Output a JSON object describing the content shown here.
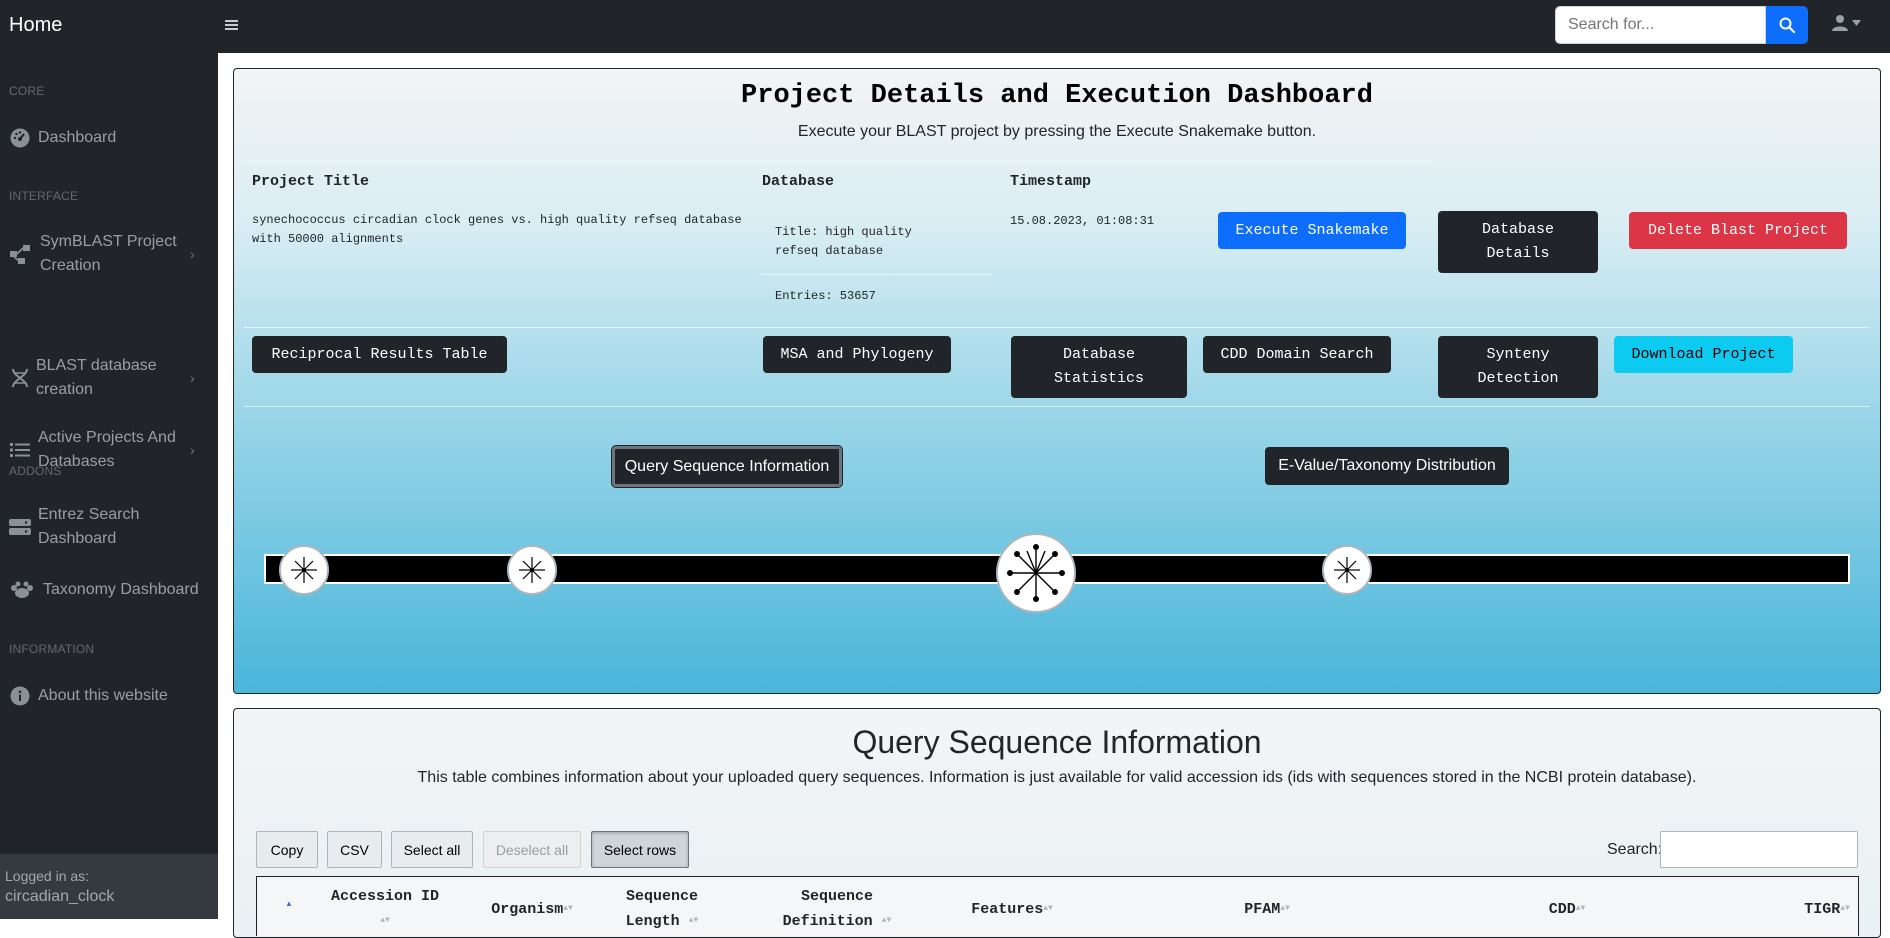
{
  "topbar": {
    "brand": "Home",
    "menu_icon": "hamburger-icon",
    "search_placeholder": "Search for...",
    "search_icon": "search-icon",
    "user_icon": "user-icon"
  },
  "sidebar": {
    "sections": {
      "core": "Core",
      "interface": "Interface",
      "addons": "Addons",
      "information": "Information"
    },
    "items": [
      {
        "label": "Dashboard",
        "icon": "dashboard-gauge-icon"
      },
      {
        "label": "SymBLAST Project Creation",
        "icon": "project-diagram-icon"
      },
      {
        "label": "BLAST database creation",
        "icon": "dna-icon"
      },
      {
        "label": "Active Projects And Databases",
        "icon": "list-icon"
      },
      {
        "label": "Entrez Search Dashboard",
        "icon": "server-icon"
      },
      {
        "label": "Taxonomy Dashboard",
        "icon": "paw-icon"
      },
      {
        "label": "About this website",
        "icon": "info-circle-icon"
      }
    ],
    "footer": {
      "label": "Logged in as:",
      "username": "circadian_clock"
    }
  },
  "dashboard": {
    "title": "Project Details and Execution Dashboard",
    "subtitle": "Execute your BLAST project by pressing the Execute Snakemake button.",
    "headers": {
      "project_title": "Project Title",
      "database": "Database",
      "timestamp": "Timestamp"
    },
    "project_title": "synechococcus circadian clock genes vs. high quality refseq database with 50000 alignments",
    "database_title": "Title: high quality refseq database",
    "database_entries": "Entries: 53657",
    "timestamp": "15.08.2023, 01:08:31",
    "buttons": {
      "execute": "Execute Snakemake",
      "database_details": "Database Details",
      "delete": "Delete Blast Project",
      "reciprocal": "Reciprocal Results Table",
      "msa": "MSA and Phylogeny",
      "db_stats": "Database Statistics",
      "cdd": "CDD Domain Search",
      "synteny": "Synteny Detection",
      "download": "Download Project"
    },
    "tabs": {
      "query_info": "Query Sequence Information",
      "evalue": "E-Value/Taxonomy Distribution"
    },
    "timeline_icons": [
      "firework-icon",
      "firework-icon",
      "fireworks-stars-icon",
      "firework-icon"
    ]
  },
  "query_section": {
    "title": "Query Sequence Information",
    "description": "This table combines information about your uploaded query sequences. Information is just available for valid accession ids (ids with sequences stored in the NCBI protein database).",
    "table_buttons": {
      "copy": "Copy",
      "csv": "CSV",
      "select_all": "Select all",
      "deselect_all": "Deselect all",
      "select_rows": "Select rows"
    },
    "search_label": "Search:",
    "columns": [
      "Accession ID",
      "Organism",
      "Sequence Length",
      "Sequence Definition",
      "Features",
      "PFAM",
      "CDD",
      "TIGR"
    ]
  }
}
